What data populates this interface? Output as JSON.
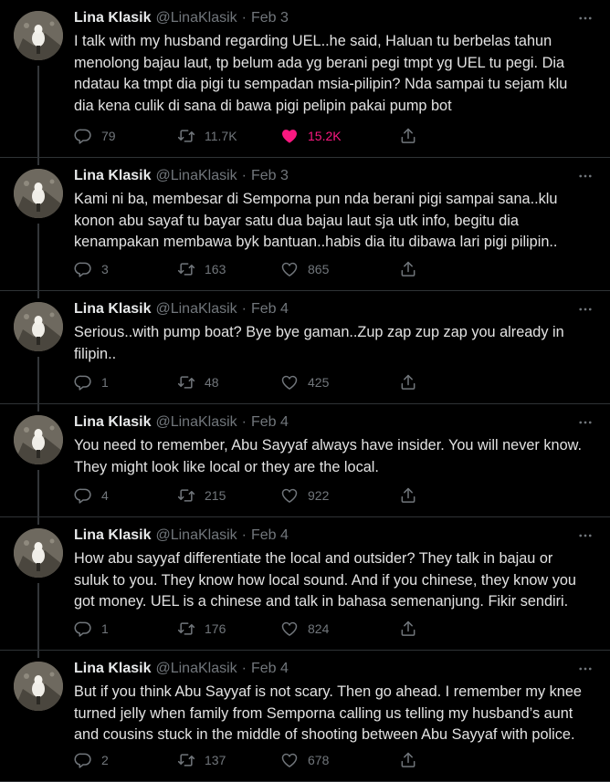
{
  "theme": {
    "background": "#000000",
    "text": "#e7e9ea",
    "muted": "#71767b",
    "like_active": "#f91880",
    "divider": "#2f3336"
  },
  "icons": {
    "reply": "reply-icon",
    "retweet": "retweet-icon",
    "like": "heart-icon",
    "share": "share-icon",
    "more": "more-icon"
  },
  "tweets": [
    {
      "name": "Lina Klasik",
      "handle": "@LinaKlasik",
      "separator": "·",
      "date": "Feb 3",
      "lines": [
        "I talk with my husband regarding UEL..he said, Haluan tu berbelas tahun",
        "menolong bajau laut, tp belum ada yg berani pegi tmpt yg UEL tu pegi. Dia",
        "ndatau ka tmpt dia pigi tu sempadan msia-pilipin? Nda sampai tu sejam klu",
        "dia kena culik di sana di bawa pigi pelipin pakai pump bot"
      ],
      "replies": "79",
      "retweets": "11.7K",
      "likes": "15.2K",
      "liked": true
    },
    {
      "name": "Lina Klasik",
      "handle": "@LinaKlasik",
      "separator": "·",
      "date": "Feb 3",
      "lines": [
        "Kami ni ba, membesar di Semporna pun nda berani pigi sampai sana..klu",
        "konon abu sayaf tu bayar satu dua bajau laut sja utk info, begitu dia",
        "kenampakan membawa byk bantuan..habis dia itu dibawa lari pigi pilipin.."
      ],
      "replies": "3",
      "retweets": "163",
      "likes": "865",
      "liked": false
    },
    {
      "name": "Lina Klasik",
      "handle": "@LinaKlasik",
      "separator": "·",
      "date": "Feb 4",
      "lines": [
        "Serious..with pump boat? Bye bye gaman..Zup zap zup zap you already in",
        "filipin.."
      ],
      "replies": "1",
      "retweets": "48",
      "likes": "425",
      "liked": false
    },
    {
      "name": "Lina Klasik",
      "handle": "@LinaKlasik",
      "separator": "·",
      "date": "Feb 4",
      "lines": [
        "You need to remember, Abu Sayyaf always have insider. You will never know.",
        "They might look like local or they are the local."
      ],
      "replies": "4",
      "retweets": "215",
      "likes": "922",
      "liked": false
    },
    {
      "name": "Lina Klasik",
      "handle": "@LinaKlasik",
      "separator": "·",
      "date": "Feb 4",
      "lines": [
        "How abu sayyaf differentiate the local and outsider? They talk in bajau or",
        "suluk to you. They know how local sound. And if you chinese, they know you",
        "got money. UEL is a chinese and talk in bahasa semenanjung. Fikir sendiri."
      ],
      "replies": "1",
      "retweets": "176",
      "likes": "824",
      "liked": false
    },
    {
      "name": "Lina Klasik",
      "handle": "@LinaKlasik",
      "separator": "·",
      "date": "Feb 4",
      "lines": [
        "But if you think Abu Sayyaf is not scary. Then go ahead. I remember my knee",
        "turned jelly when family from Semporna calling us telling my husband’s aunt",
        "and cousins stuck in the middle of shooting between Abu Sayyaf with police."
      ],
      "replies": "2",
      "retweets": "137",
      "likes": "678",
      "liked": false
    }
  ]
}
